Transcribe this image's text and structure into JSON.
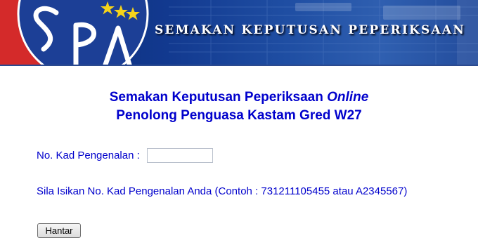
{
  "banner": {
    "title": "SEMAKAN KEPUTUSAN PEPERIKSAAN",
    "logo_text": "SPA"
  },
  "heading": {
    "line1_prefix": "Semakan Keputusan Peperiksaan ",
    "line1_italic": "Online",
    "line2": "Penolong Penguasa Kastam Gred W27"
  },
  "form": {
    "ic_label": "No. Kad Pengenalan :",
    "ic_value": "",
    "hint": "Sila Isikan No. Kad Pengenalan Anda (Contoh : 731211105455 atau A2345567)",
    "submit_label": "Hantar"
  },
  "colors": {
    "text_blue": "#0000cc",
    "banner_blue": "#12398f",
    "logo_red": "#d42a2a",
    "star_yellow": "#f5d31a"
  }
}
